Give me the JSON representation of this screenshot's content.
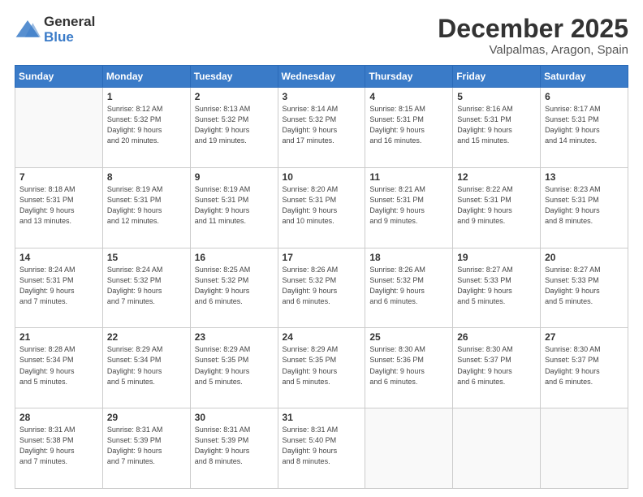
{
  "logo": {
    "general": "General",
    "blue": "Blue"
  },
  "title": {
    "month": "December 2025",
    "location": "Valpalmas, Aragon, Spain"
  },
  "weekdays": [
    "Sunday",
    "Monday",
    "Tuesday",
    "Wednesday",
    "Thursday",
    "Friday",
    "Saturday"
  ],
  "weeks": [
    [
      {
        "day": "",
        "info": ""
      },
      {
        "day": "1",
        "info": "Sunrise: 8:12 AM\nSunset: 5:32 PM\nDaylight: 9 hours\nand 20 minutes."
      },
      {
        "day": "2",
        "info": "Sunrise: 8:13 AM\nSunset: 5:32 PM\nDaylight: 9 hours\nand 19 minutes."
      },
      {
        "day": "3",
        "info": "Sunrise: 8:14 AM\nSunset: 5:32 PM\nDaylight: 9 hours\nand 17 minutes."
      },
      {
        "day": "4",
        "info": "Sunrise: 8:15 AM\nSunset: 5:31 PM\nDaylight: 9 hours\nand 16 minutes."
      },
      {
        "day": "5",
        "info": "Sunrise: 8:16 AM\nSunset: 5:31 PM\nDaylight: 9 hours\nand 15 minutes."
      },
      {
        "day": "6",
        "info": "Sunrise: 8:17 AM\nSunset: 5:31 PM\nDaylight: 9 hours\nand 14 minutes."
      }
    ],
    [
      {
        "day": "7",
        "info": "Sunrise: 8:18 AM\nSunset: 5:31 PM\nDaylight: 9 hours\nand 13 minutes."
      },
      {
        "day": "8",
        "info": "Sunrise: 8:19 AM\nSunset: 5:31 PM\nDaylight: 9 hours\nand 12 minutes."
      },
      {
        "day": "9",
        "info": "Sunrise: 8:19 AM\nSunset: 5:31 PM\nDaylight: 9 hours\nand 11 minutes."
      },
      {
        "day": "10",
        "info": "Sunrise: 8:20 AM\nSunset: 5:31 PM\nDaylight: 9 hours\nand 10 minutes."
      },
      {
        "day": "11",
        "info": "Sunrise: 8:21 AM\nSunset: 5:31 PM\nDaylight: 9 hours\nand 9 minutes."
      },
      {
        "day": "12",
        "info": "Sunrise: 8:22 AM\nSunset: 5:31 PM\nDaylight: 9 hours\nand 9 minutes."
      },
      {
        "day": "13",
        "info": "Sunrise: 8:23 AM\nSunset: 5:31 PM\nDaylight: 9 hours\nand 8 minutes."
      }
    ],
    [
      {
        "day": "14",
        "info": "Sunrise: 8:24 AM\nSunset: 5:31 PM\nDaylight: 9 hours\nand 7 minutes."
      },
      {
        "day": "15",
        "info": "Sunrise: 8:24 AM\nSunset: 5:32 PM\nDaylight: 9 hours\nand 7 minutes."
      },
      {
        "day": "16",
        "info": "Sunrise: 8:25 AM\nSunset: 5:32 PM\nDaylight: 9 hours\nand 6 minutes."
      },
      {
        "day": "17",
        "info": "Sunrise: 8:26 AM\nSunset: 5:32 PM\nDaylight: 9 hours\nand 6 minutes."
      },
      {
        "day": "18",
        "info": "Sunrise: 8:26 AM\nSunset: 5:32 PM\nDaylight: 9 hours\nand 6 minutes."
      },
      {
        "day": "19",
        "info": "Sunrise: 8:27 AM\nSunset: 5:33 PM\nDaylight: 9 hours\nand 5 minutes."
      },
      {
        "day": "20",
        "info": "Sunrise: 8:27 AM\nSunset: 5:33 PM\nDaylight: 9 hours\nand 5 minutes."
      }
    ],
    [
      {
        "day": "21",
        "info": "Sunrise: 8:28 AM\nSunset: 5:34 PM\nDaylight: 9 hours\nand 5 minutes."
      },
      {
        "day": "22",
        "info": "Sunrise: 8:29 AM\nSunset: 5:34 PM\nDaylight: 9 hours\nand 5 minutes."
      },
      {
        "day": "23",
        "info": "Sunrise: 8:29 AM\nSunset: 5:35 PM\nDaylight: 9 hours\nand 5 minutes."
      },
      {
        "day": "24",
        "info": "Sunrise: 8:29 AM\nSunset: 5:35 PM\nDaylight: 9 hours\nand 5 minutes."
      },
      {
        "day": "25",
        "info": "Sunrise: 8:30 AM\nSunset: 5:36 PM\nDaylight: 9 hours\nand 6 minutes."
      },
      {
        "day": "26",
        "info": "Sunrise: 8:30 AM\nSunset: 5:37 PM\nDaylight: 9 hours\nand 6 minutes."
      },
      {
        "day": "27",
        "info": "Sunrise: 8:30 AM\nSunset: 5:37 PM\nDaylight: 9 hours\nand 6 minutes."
      }
    ],
    [
      {
        "day": "28",
        "info": "Sunrise: 8:31 AM\nSunset: 5:38 PM\nDaylight: 9 hours\nand 7 minutes."
      },
      {
        "day": "29",
        "info": "Sunrise: 8:31 AM\nSunset: 5:39 PM\nDaylight: 9 hours\nand 7 minutes."
      },
      {
        "day": "30",
        "info": "Sunrise: 8:31 AM\nSunset: 5:39 PM\nDaylight: 9 hours\nand 8 minutes."
      },
      {
        "day": "31",
        "info": "Sunrise: 8:31 AM\nSunset: 5:40 PM\nDaylight: 9 hours\nand 8 minutes."
      },
      {
        "day": "",
        "info": ""
      },
      {
        "day": "",
        "info": ""
      },
      {
        "day": "",
        "info": ""
      }
    ]
  ]
}
